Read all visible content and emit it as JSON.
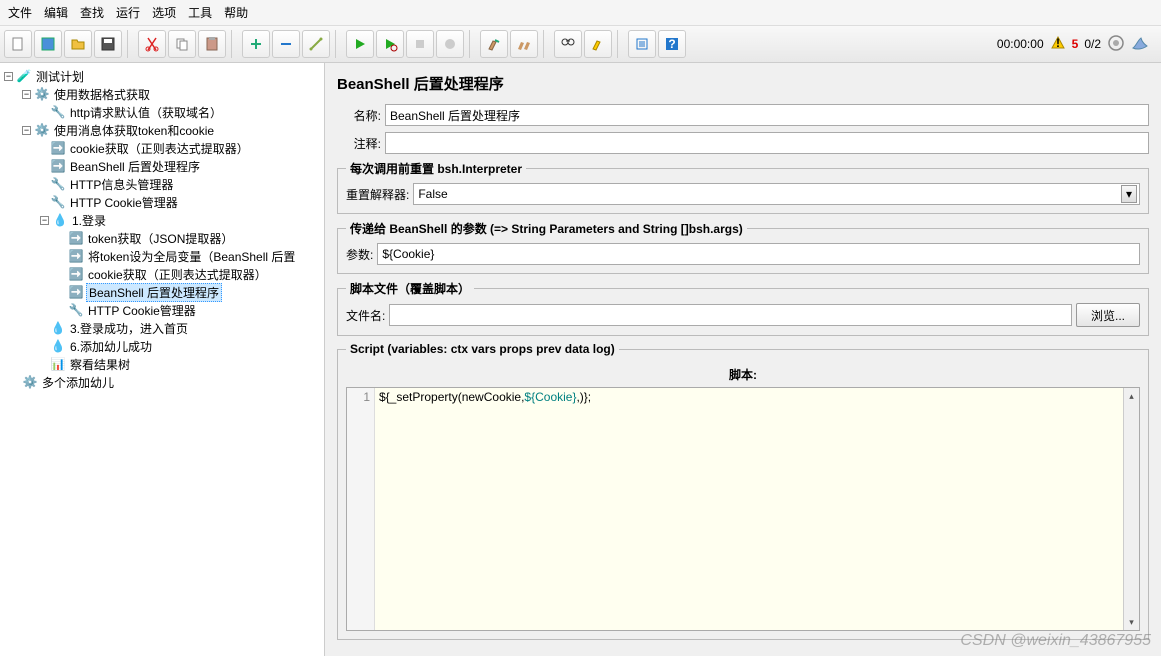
{
  "menu": [
    "文件",
    "编辑",
    "查找",
    "运行",
    "选项",
    "工具",
    "帮助"
  ],
  "status": {
    "time": "00:00:00",
    "warnings": "5",
    "ratio": "0/2"
  },
  "tree": {
    "root": "测试计划",
    "n1": "使用数据格式获取",
    "n1a": "http请求默认值（获取域名）",
    "n2": "使用消息体获取token和cookie",
    "n2a": "cookie获取（正则表达式提取器）",
    "n2b": "BeanShell 后置处理程序",
    "n2c": "HTTP信息头管理器",
    "n2d": "HTTP Cookie管理器",
    "n2e": "1.登录",
    "n2e1": "token获取（JSON提取器）",
    "n2e2": "将token设为全局变量（BeanShell 后置",
    "n2e3": "cookie获取（正则表达式提取器）",
    "n2e4": "BeanShell 后置处理程序",
    "n2e5": "HTTP Cookie管理器",
    "n2f": "3.登录成功，进入首页",
    "n2g": "6.添加幼儿成功",
    "n2h": "察看结果树",
    "n3": "多个添加幼儿"
  },
  "panel": {
    "title": "BeanShell 后置处理程序",
    "name_label": "名称:",
    "name_value": "BeanShell 后置处理程序",
    "comment_label": "注释:",
    "comment_value": "",
    "reset_legend": "每次调用前重置 bsh.Interpreter",
    "reset_label": "重置解释器:",
    "reset_value": "False",
    "params_legend": "传递给 BeanShell 的参数 (=> String Parameters and String []bsh.args)",
    "params_label": "参数:",
    "params_value": "${Cookie}",
    "file_legend": "脚本文件（覆盖脚本）",
    "file_label": "文件名:",
    "file_value": "",
    "browse": "浏览...",
    "script_legend": "Script (variables: ctx vars props prev data log)",
    "script_label": "脚本:",
    "script_line": "1",
    "script_code_a": "${_setProperty(newCookie,",
    "script_code_b": "${Cookie}",
    "script_code_c": ",)};"
  },
  "watermark": "CSDN @weixin_43867955"
}
